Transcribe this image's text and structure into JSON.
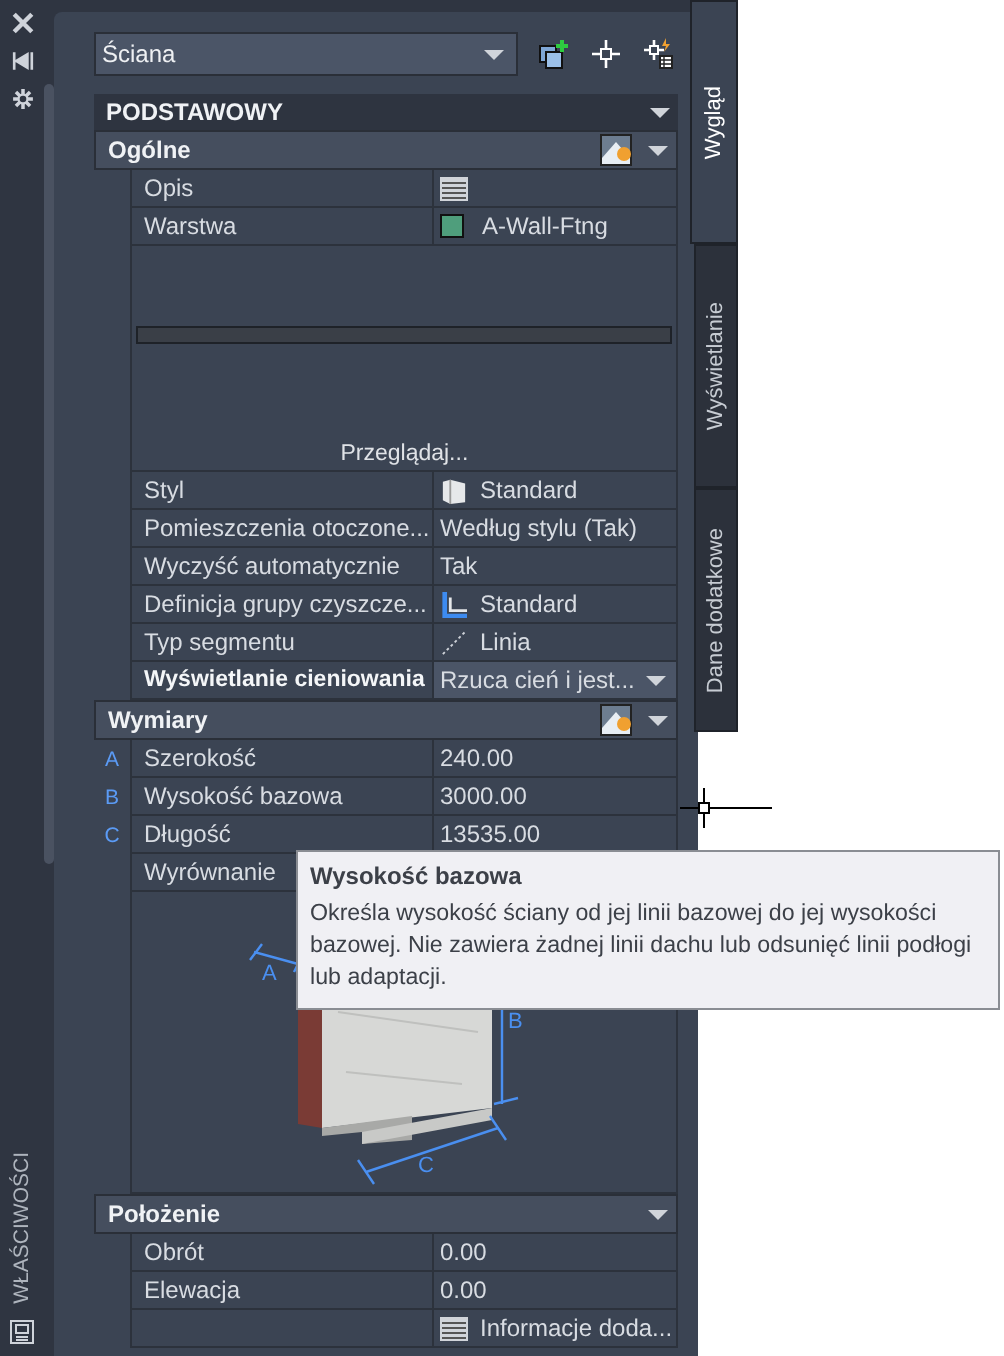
{
  "sidebar": {
    "label": "WŁAŚCIWOŚCI"
  },
  "object_type": {
    "value": "Ściana"
  },
  "category": {
    "title": "PODSTAWOWY"
  },
  "sections": [
    {
      "title": "Ogólne",
      "style_button": true,
      "rows": [
        {
          "kind": "notes",
          "label": "Opis"
        },
        {
          "kind": "layer",
          "label": "Warstwa",
          "value": "A-Wall-Ftng",
          "color": "#4f9e7c"
        },
        {
          "kind": "preview",
          "button": "Przeglądaj..."
        },
        {
          "kind": "style",
          "label": "Styl",
          "value": "Standard"
        },
        {
          "kind": "text",
          "label": "Pomieszczenia  otoczone...",
          "value": "Według stylu (Tak)"
        },
        {
          "kind": "text",
          "label": "Wyczyść automatycznie",
          "value": "Tak"
        },
        {
          "kind": "cleanup-group",
          "label": "Definicja  grupy  czyszcze...",
          "value": "Standard"
        },
        {
          "kind": "segment",
          "label": "Typ segmentu",
          "value": "Linia"
        },
        {
          "kind": "dropdown",
          "label": "Wyświetlanie cieniowania",
          "value": "Rzuca cień i jest..."
        }
      ]
    },
    {
      "title": "Wymiary",
      "style_button": true,
      "rows": [
        {
          "kind": "text",
          "marker": "A",
          "label": "Szerokość",
          "value": "240.00"
        },
        {
          "kind": "text",
          "marker": "B",
          "label": "Wysokość bazowa",
          "value": "3000.00"
        },
        {
          "kind": "text",
          "marker": "C",
          "label": "Długość",
          "value": "13535.00"
        },
        {
          "kind": "text",
          "label": "Wyrównanie"
        },
        {
          "kind": "diagram",
          "labels": [
            "A",
            "B",
            "C"
          ]
        }
      ]
    },
    {
      "title": "Położenie",
      "style_button": false,
      "rows": [
        {
          "kind": "text",
          "label": "Obrót",
          "value": "0.00"
        },
        {
          "kind": "text",
          "label": "Elewacja",
          "value": "0.00"
        },
        {
          "kind": "info",
          "value": "Informacje  doda..."
        }
      ]
    }
  ],
  "tabs": [
    {
      "label": "Wygląd",
      "selected": true
    },
    {
      "label": "Wyświetlanie",
      "selected": false
    },
    {
      "label": "Dane dodatkowe",
      "selected": false
    }
  ],
  "tooltip": {
    "title": "Wysokość bazowa",
    "text": "Określa wysokość ściany od jej linii bazowej do jej wysokości bazowej. Nie zawiera żadnej linii dachu lub odsunięć linii podłogi lub adaptacji."
  }
}
